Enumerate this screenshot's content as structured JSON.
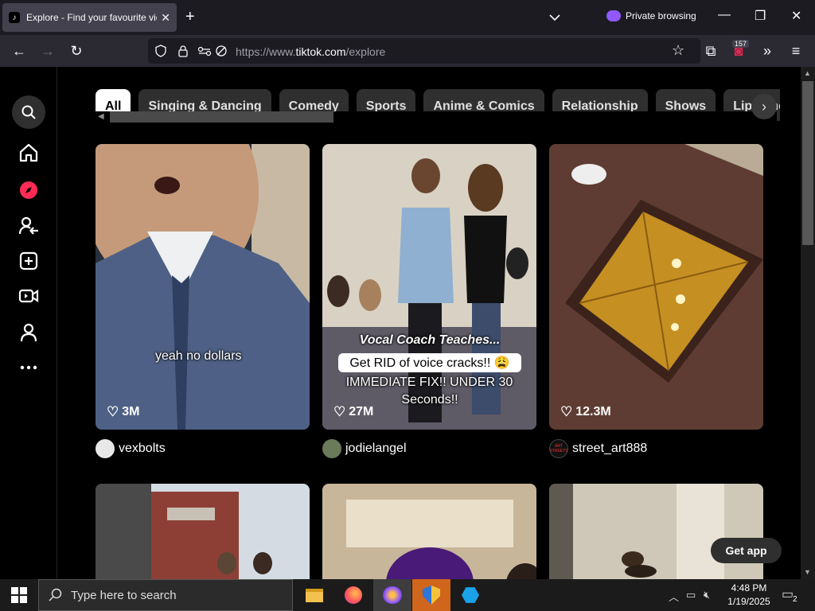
{
  "browser": {
    "tab_title": "Explore - Find your favourite videos on TikTok",
    "tab_favicon": "tiktok-icon",
    "private_label": "Private browsing",
    "url_prefix": "https://www.",
    "url_host": "tiktok.com",
    "url_path": "/explore",
    "extension_badge": "157"
  },
  "categories": [
    "All",
    "Singing & Dancing",
    "Comedy",
    "Sports",
    "Anime & Comics",
    "Relationship",
    "Shows",
    "Lip-sync"
  ],
  "active_category": "All",
  "videos": [
    {
      "caption": "yeah no dollars",
      "likes": "3M",
      "author": "vexbolts"
    },
    {
      "caption_lines": [
        "Vocal Coach Teaches...",
        "Get RID of voice cracks!! 😩",
        "IMMEDIATE FIX!! UNDER 30",
        "Seconds!!"
      ],
      "likes": "27M",
      "author": "jodielangel"
    },
    {
      "likes": "12.3M",
      "author": "street_art888",
      "avatar_text": "ART STREETS"
    }
  ],
  "get_app_label": "Get app",
  "taskbar": {
    "search_placeholder": "Type here to search",
    "time": "4:48 PM",
    "date": "1/19/2025",
    "notifications": "2"
  },
  "colors": {
    "accent_red": "#fe2c55",
    "private_purple": "#9059ff"
  }
}
